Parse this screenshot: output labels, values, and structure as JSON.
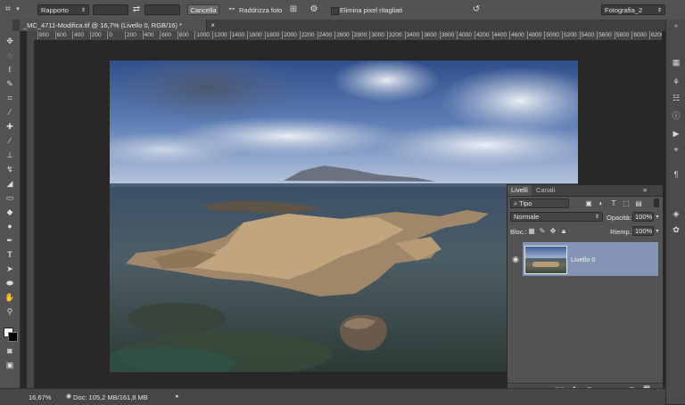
{
  "options_bar": {
    "ratio_label": "Rapporto",
    "clear_button": "Cancella",
    "straighten_label": "Raddrizza foto",
    "delete_cropped_label": "Elimina pixel ritagliati",
    "workspace_label": "Fotografia_2"
  },
  "document": {
    "tab_title": "_MC_4711-Modifica.tif @ 16,7% (Livello 0, RGB/16) *",
    "zoom": "16,67%",
    "doc_info": "Doc: 105,2 MB/161,8 MB"
  },
  "ruler": {
    "ticks": [
      "800",
      "600",
      "400",
      "200",
      "0",
      "200",
      "400",
      "600",
      "800",
      "1000",
      "1200",
      "1400",
      "1600",
      "1800",
      "2000",
      "2200",
      "2400",
      "2600",
      "2800",
      "3000",
      "3200",
      "3400",
      "3600",
      "3800",
      "4000",
      "4200",
      "4400",
      "4600",
      "4800",
      "5000",
      "5200",
      "5400",
      "5600",
      "5800",
      "6000",
      "6200"
    ]
  },
  "layers_panel": {
    "tab_layers": "Livelli",
    "tab_channels": "Canali",
    "filter_kind": "Tipo",
    "blend_mode": "Normale",
    "opacity_label": "Opacità:",
    "opacity_value": "100%",
    "lock_label": "Bloc.:",
    "fill_label": "Riemp.:",
    "fill_value": "100%",
    "layer_name": "Livello 0"
  },
  "colors": {
    "accent_selected_layer": "#8394b5",
    "panel_bg": "#535353",
    "canvas_bg": "#282828"
  }
}
